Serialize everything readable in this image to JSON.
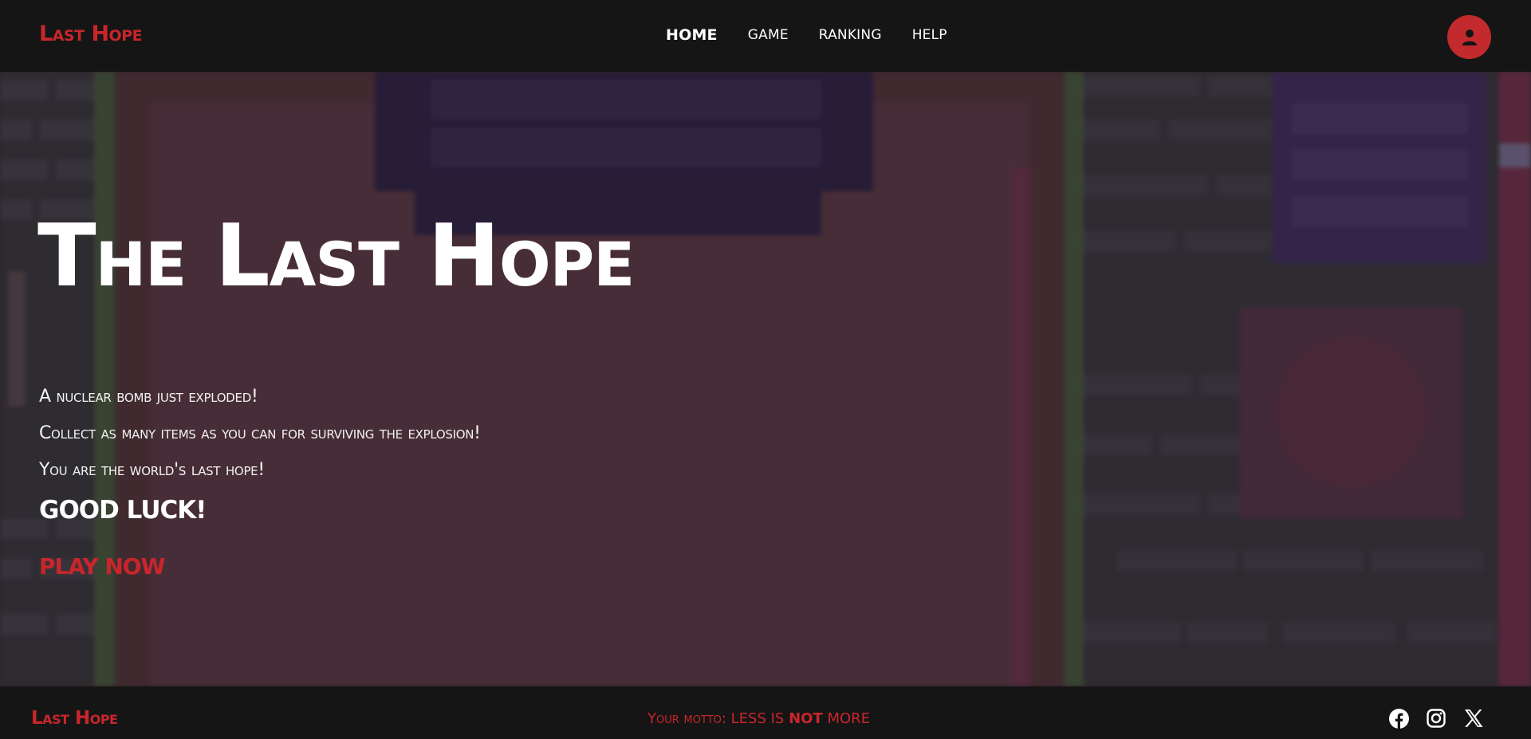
{
  "header": {
    "brand": "Last Hope",
    "nav": [
      {
        "label": "HOME",
        "active": true
      },
      {
        "label": "GAME",
        "active": false
      },
      {
        "label": "RANKING",
        "active": false
      },
      {
        "label": "HELP",
        "active": false
      }
    ],
    "avatar_icon": "user-icon"
  },
  "hero": {
    "title": "The Last Hope",
    "lines": [
      "A nuclear bomb just exploded!",
      "Collect as many items as you can for surviving the explosion!",
      "You are the world's last hope!"
    ],
    "good_luck": "GOOD LUCK!",
    "cta": "PLAY NOW"
  },
  "footer": {
    "brand": "Last Hope",
    "motto": {
      "label": "Your motto:",
      "part1": "LESS IS",
      "strong": "NOT",
      "part2": "MORE"
    },
    "socials": [
      {
        "icon": "facebook-icon"
      },
      {
        "icon": "instagram-icon"
      },
      {
        "icon": "x-icon"
      }
    ]
  },
  "colors": {
    "accent": "#c8262b",
    "header_bg": "#151515",
    "text": "#ffffff"
  }
}
